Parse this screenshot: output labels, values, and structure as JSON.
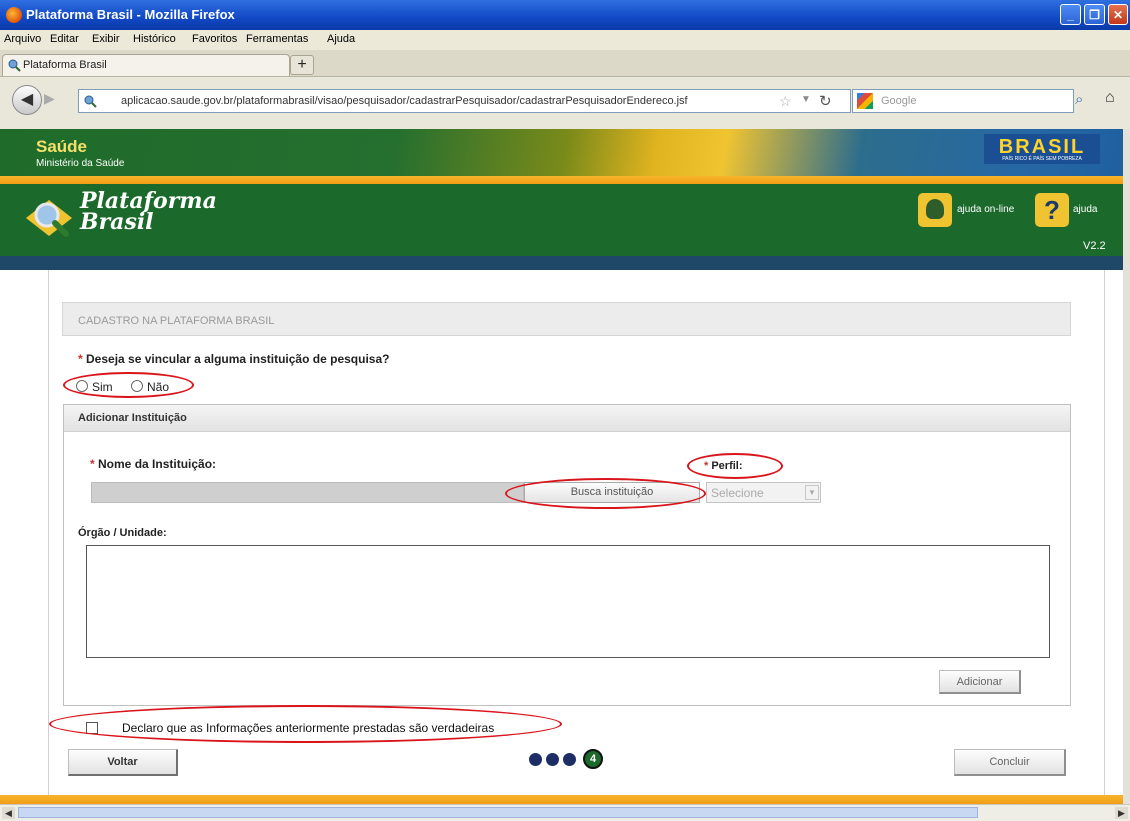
{
  "window": {
    "title": "Plataforma Brasil - Mozilla Firefox",
    "controls": [
      "minimize",
      "maximize",
      "close"
    ]
  },
  "menubar": {
    "items": [
      "Arquivo",
      "Editar",
      "Exibir",
      "Histórico",
      "Favoritos",
      "Ferramentas",
      "Ajuda"
    ]
  },
  "tabs": [
    {
      "label": "Plataforma Brasil",
      "active": true
    }
  ],
  "new_tab_label": "+",
  "navbar": {
    "url": "aplicacao.saude.gov.br/plataformabrasil/visao/pesquisador/cadastrarPesquisador/cadastrarPesquisadorEndereco.jsf",
    "search_placeholder": "Google"
  },
  "site_header": {
    "saude_title": "Saúde",
    "saude_subtitle": "Ministério da Saúde",
    "brasil_logo": "BRASIL",
    "brasil_slogan": "PAÍS RICO É PAÍS SEM POBREZA",
    "logo_line1": "Plataforma",
    "logo_line2": "Brasil",
    "help_online_label": "ajuda on-line",
    "help_label": "ajuda",
    "help_icon_glyph": "?",
    "version": "V2.2"
  },
  "form": {
    "page_heading": "CADASTRO NA PLATAFORMA BRASIL",
    "required_marker": "*",
    "question": "Deseja se vincular a alguma instituição de pesquisa?",
    "options": [
      {
        "label": "Sim",
        "selected": false
      },
      {
        "label": "Não",
        "selected": false
      }
    ],
    "panel_title": "Adicionar Instituição",
    "nome_label": "Nome da Instituição:",
    "busca_button": "Busca instituição",
    "perfil_label": "Perfil:",
    "perfil_selected": "Selecione",
    "orgao_label": "Órgão / Unidade:",
    "adicionar_button": "Adicionar",
    "declaro_label": "Declaro que as Informações anteriormente prestadas são verdadeiras",
    "declaro_checked": false,
    "voltar_button": "Voltar",
    "concluir_button": "Concluir",
    "current_step": "4",
    "steps_total_shown": 4
  },
  "colors": {
    "header_green": "#1b6a2c",
    "accent_orange": "#f0a21a",
    "annotation_red": "#d9151b",
    "step_dark_blue": "#1d2d66"
  }
}
